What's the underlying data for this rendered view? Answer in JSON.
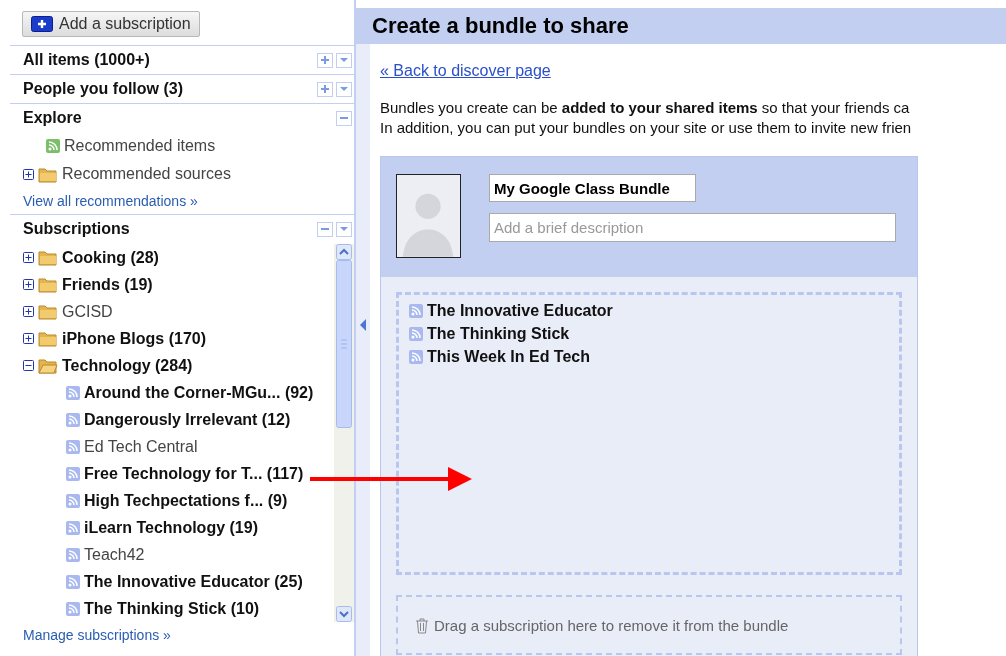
{
  "sidebar": {
    "add_button": "Add a subscription",
    "headers": [
      {
        "title": "All items (1000+)",
        "buttons": [
          {
            "kind": "plus"
          },
          {
            "kind": "menu"
          }
        ]
      },
      {
        "title": "People you follow (3)",
        "buttons": [
          {
            "kind": "plus"
          },
          {
            "kind": "menu"
          }
        ]
      }
    ],
    "explore": {
      "title": "Explore",
      "buttons": [
        {
          "kind": "minus"
        }
      ],
      "items": [
        {
          "kind": "feed",
          "label": "Recommended items",
          "unread": false
        },
        {
          "kind": "folder",
          "label": "Recommended sources",
          "expanded": false,
          "unread": false
        }
      ],
      "link": "View all recommendations »"
    },
    "subscriptions": {
      "title": "Subscriptions",
      "buttons": [
        {
          "kind": "minus"
        },
        {
          "kind": "menu"
        }
      ],
      "items": [
        {
          "kind": "folder",
          "label": "Cooking (28)",
          "expanded": false,
          "unread": true
        },
        {
          "kind": "folder",
          "label": "Friends (19)",
          "expanded": false,
          "unread": true
        },
        {
          "kind": "folder",
          "label": "GCISD",
          "expanded": false,
          "unread": false
        },
        {
          "kind": "folder",
          "label": "iPhone Blogs (170)",
          "expanded": false,
          "unread": true
        },
        {
          "kind": "folder",
          "label": "Technology (284)",
          "expanded": true,
          "unread": true,
          "children": [
            {
              "kind": "feed",
              "label": "Around the Corner-MGu... (92)",
              "unread": true
            },
            {
              "kind": "feed",
              "label": "Dangerously Irrelevant (12)",
              "unread": true
            },
            {
              "kind": "feed",
              "label": "Ed Tech Central",
              "unread": false
            },
            {
              "kind": "feed",
              "label": "Free Technology for T... (117)",
              "unread": true
            },
            {
              "kind": "feed",
              "label": "High Techpectations f... (9)",
              "unread": true
            },
            {
              "kind": "feed",
              "label": "iLearn Technology (19)",
              "unread": true
            },
            {
              "kind": "feed",
              "label": "Teach42",
              "unread": false
            },
            {
              "kind": "feed",
              "label": "The Innovative Educator (25)",
              "unread": true
            },
            {
              "kind": "feed",
              "label": "The Thinking Stick (10)",
              "unread": true
            }
          ]
        }
      ],
      "link": "Manage subscriptions »"
    }
  },
  "main": {
    "title": "Create a bundle to share",
    "back_link": "« Back to discover page",
    "intro": [
      "Bundles you create can be **added to your shared items** so that your friends ca",
      "In addition, you can put your bundles on your site or use them to invite new frien"
    ],
    "bundle": {
      "name": "My Google Class Bundle",
      "description_placeholder": "Add a brief description",
      "items": [
        "The Innovative Educator",
        "The Thinking Stick",
        "This Week In Ed Tech"
      ],
      "trash_hint": "Drag a subscription here to remove it from the bundle"
    }
  }
}
